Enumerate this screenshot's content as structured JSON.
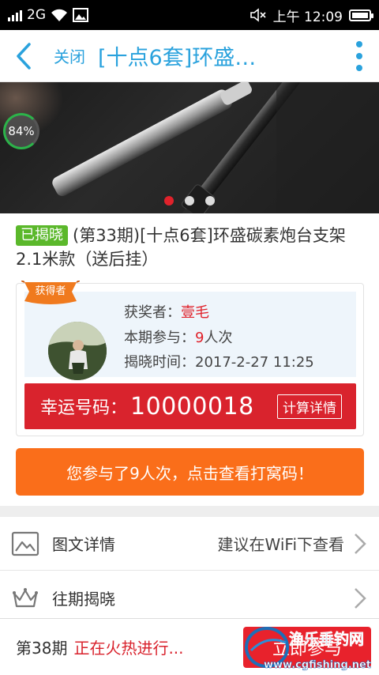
{
  "status_bar": {
    "network": "2G",
    "time": "上午 12:09"
  },
  "nav": {
    "close_label": "关闭",
    "title": "[十点6套]环盛…"
  },
  "banner": {
    "progress_percent": 84,
    "progress_text": "84%",
    "slide_count": 3,
    "active_slide": 0
  },
  "product": {
    "status_tag": "已揭晓",
    "title": "(第33期)[十点6套]环盛碳素炮台支架2.1米款（送后挂）"
  },
  "winner": {
    "badge": "获得者",
    "winner_label": "获奖者：",
    "winner_name": "壹毛",
    "participation_label": "本期参与：",
    "participation_count": "9",
    "participation_unit": "人次",
    "reveal_label": "揭晓时间：",
    "reveal_time": "2017-2-27 11:25"
  },
  "lucky": {
    "label": "幸运号码：",
    "number": "10000018",
    "calc_label": "计算详情"
  },
  "joined_button": "您参与了9人次，点击查看打窝码！",
  "list": {
    "details_label": "图文详情",
    "details_hint": "建议在WiFi下查看",
    "history_label": "往期揭晓"
  },
  "bottom": {
    "period": "第38期",
    "status": "正在火热进行...",
    "button": "立即参与"
  },
  "watermark": {
    "name": "渔乐垂钓网",
    "url": "www.cgfishing.net"
  },
  "colors": {
    "accent_blue": "#2aa2dd",
    "red": "#d9232d",
    "orange": "#fa6e1a",
    "green_tag": "#5bb82b"
  }
}
